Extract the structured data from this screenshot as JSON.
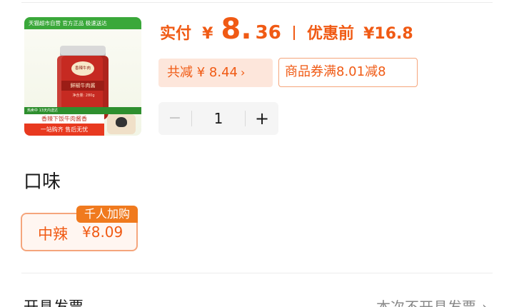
{
  "product": {
    "image": {
      "banner": "天猫超市自营 官方正品 极速送达",
      "jar_brand": "香辣牛肉",
      "jar_label": "鲜椒牛肉酱",
      "jar_weight": "净含量: 280g",
      "strip_text": "热卖中 13天内送达",
      "promo_line": "香辣下饭牛肉酱香",
      "promo_red": "一站购齐 售后无忧"
    }
  },
  "price": {
    "label": "实付",
    "currency": "¥",
    "integer": "8.",
    "decimal": "36",
    "original_label": "优惠前",
    "original_value": "¥16.8"
  },
  "discount": {
    "label": "共减 ¥ 8.44",
    "chevron": "›"
  },
  "coupon": {
    "label": "商品券满8.01减8"
  },
  "stepper": {
    "minus": "−",
    "quantity": "1",
    "plus": "+"
  },
  "flavor": {
    "title": "口味",
    "option": {
      "name": "中辣",
      "price": "¥8.09",
      "badge": "千人加购"
    }
  },
  "invoice": {
    "label": "开具发票",
    "value": "本次不开具发票",
    "chevron": "›"
  },
  "colors": {
    "accent": "#f05a14",
    "accent_light_bg": "#fde6db",
    "border_accent": "#f5a57c",
    "badge": "#f07a1e"
  }
}
